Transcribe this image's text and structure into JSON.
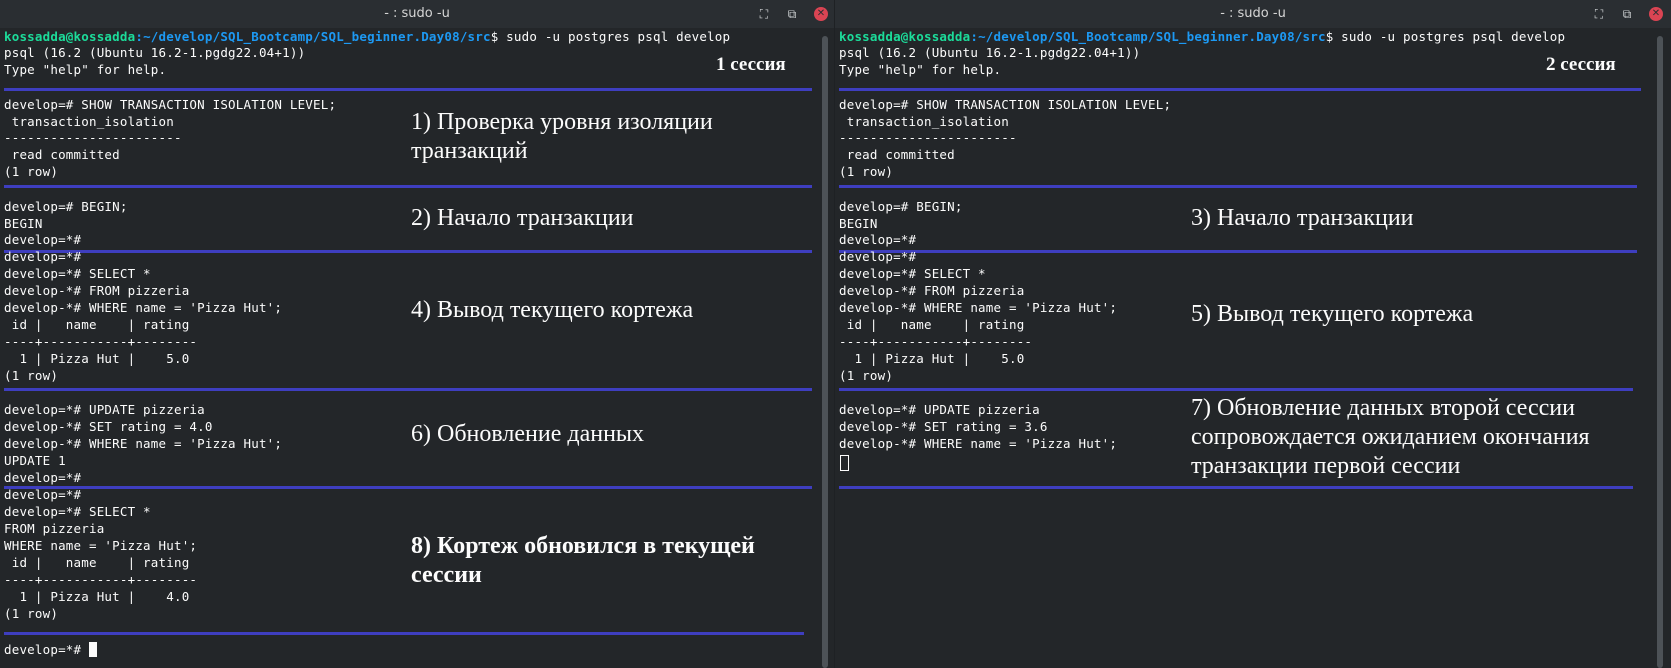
{
  "window1": {
    "title": "- : sudo -u",
    "prompt_user": "kossadda@kossadda",
    "prompt_path": ":~/develop/SQL_Bootcamp/SQL_beginner.Day08/src",
    "prompt_cmd": "$ sudo -u postgres psql develop",
    "lines": {
      "l1": "psql (16.2 (Ubuntu 16.2-1.pgdg22.04+1))",
      "l2": "Type \"help\" for help.",
      "l3": "develop=# SHOW TRANSACTION ISOLATION LEVEL;",
      "l4": " transaction_isolation",
      "l5": "-----------------------",
      "l6": " read committed",
      "l7": "(1 row)",
      "l8": "develop=# BEGIN;",
      "l9": "BEGIN",
      "l10": "develop=*#",
      "l11": "develop=*#",
      "l12": "develop=*# SELECT *",
      "l13": "develop-*# FROM pizzeria",
      "l14": "develop-*# WHERE name = 'Pizza Hut';",
      "l15": " id |   name    | rating",
      "l16": "----+-----------+--------",
      "l17": "  1 | Pizza Hut |    5.0",
      "l18": "(1 row)",
      "l19": "develop=*# UPDATE pizzeria",
      "l20": "develop-*# SET rating = 4.0",
      "l21": "develop-*# WHERE name = 'Pizza Hut';",
      "l22": "UPDATE 1",
      "l23": "develop=*#",
      "l24": "develop=*#",
      "l25": "develop=*# SELECT *",
      "l26": "FROM pizzeria",
      "l27": "WHERE name = 'Pizza Hut';",
      "l28": " id |   name    | rating",
      "l29": "----+-----------+--------",
      "l30": "  1 | Pizza Hut |    4.0",
      "l31": "(1 row)",
      "l32": "develop=*# "
    },
    "session_label": "1 сессия",
    "notes": {
      "n1": "1) Проверка уровня изоляции\nтранзакций",
      "n2": "2) Начало транзакции",
      "n4": "4) Вывод текущего кортежа",
      "n6": "6) Обновление данных",
      "n8": "8) Кортеж обновился в текущей\nсессии"
    }
  },
  "window2": {
    "title": "- : sudo -u",
    "prompt_user": "kossadda@kossadda",
    "prompt_path": ":~/develop/SQL_Bootcamp/SQL_beginner.Day08/src",
    "prompt_cmd": "$ sudo -u postgres psql develop",
    "lines": {
      "l1": "psql (16.2 (Ubuntu 16.2-1.pgdg22.04+1))",
      "l2": "Type \"help\" for help.",
      "l3": "develop=# SHOW TRANSACTION ISOLATION LEVEL;",
      "l4": " transaction_isolation",
      "l5": "-----------------------",
      "l6": " read committed",
      "l7": "(1 row)",
      "l8": "develop=# BEGIN;",
      "l9": "BEGIN",
      "l10": "develop=*#",
      "l11": "develop=*#",
      "l12": "develop=*# SELECT *",
      "l13": "develop-*# FROM pizzeria",
      "l14": "develop-*# WHERE name = 'Pizza Hut';",
      "l15": " id |   name    | rating",
      "l16": "----+-----------+--------",
      "l17": "  1 | Pizza Hut |    5.0",
      "l18": "(1 row)",
      "l19": "develop=*# UPDATE pizzeria",
      "l20": "develop-*# SET rating = 3.6",
      "l21": "develop-*# WHERE name = 'Pizza Hut';"
    },
    "session_label": "2 сессия",
    "notes": {
      "n3": "3) Начало транзакции",
      "n5": "5) Вывод текущего кортежа",
      "n7": "7) Обновление данных второй сессии\nсопровождается ожиданием окончания\nтранзакции первой сессии"
    }
  },
  "colors": {
    "background": "#232629",
    "prompt_user": "#1cdc9a",
    "prompt_path": "#1d99f3",
    "separator": "#3e3ebf",
    "close_button": "#da4453"
  },
  "icons": [
    "maximize-icon",
    "new-tab-icon",
    "close-icon"
  ]
}
